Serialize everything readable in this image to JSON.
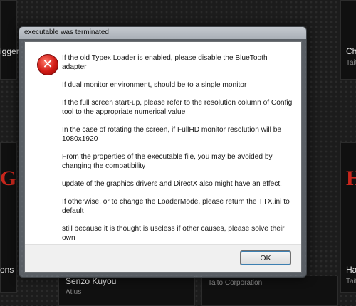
{
  "background": {
    "tiles": [
      {
        "title": "igger"
      },
      {
        "title": "Ch",
        "subtitle": "Taito"
      },
      {
        "title": "ons"
      },
      {
        "title": "Senzo Kuyou",
        "subtitle": "Atlus"
      },
      {
        "title": "",
        "subtitle": "Taito Corporation"
      },
      {
        "title": "Ha",
        "subtitle": "Taito"
      }
    ]
  },
  "dialog": {
    "title": "executable was terminated",
    "icon": "error-icon",
    "messages": [
      "If the old Typex Loader is enabled, please disable the BlueTooth adapter",
      "If dual monitor environment, should be to a single monitor",
      "If the full screen start-up, please refer to the resolution column of Config tool to the appropriate numerical value",
      "In the case of rotating the screen, if FullHD monitor resolution will be 1080x1920",
      "From the properties of the executable file, you may be avoided by changing the compatibility",
      "update of the graphics drivers and DirectX also might have an effect.",
      "If otherwise, or to change the LoaderMode, please return the TTX.ini to default",
      "still because it is thought is useless if other causes, please solve their own"
    ],
    "ok_label": "OK"
  }
}
